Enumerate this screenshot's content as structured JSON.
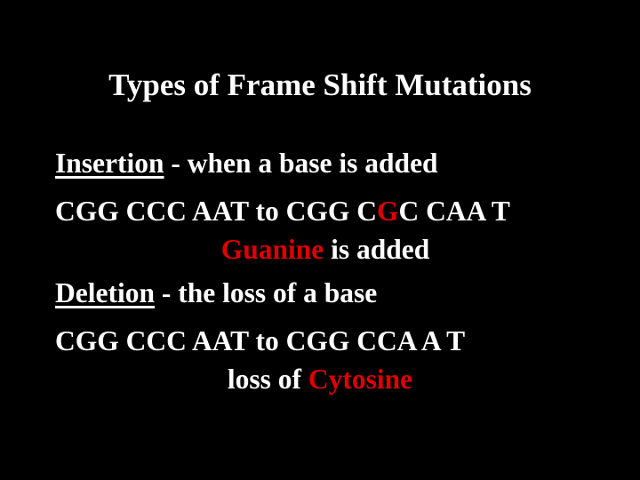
{
  "slide": {
    "title": "Types of Frame Shift Mutations",
    "accent_color": "#e00000",
    "insertion": {
      "term": "Insertion",
      "definition": " - when a base is added",
      "sequence_before": "CGG CCC AAT to CGG C",
      "sequence_highlight": "G",
      "sequence_after": "C CAA T",
      "note_highlight": "Guanine",
      "note_rest": " is added"
    },
    "deletion": {
      "term": "Deletion",
      "definition": " - the loss of a base",
      "sequence": "CGG CCC AAT to CGG CCA A T",
      "note_prefix": "loss of ",
      "note_highlight": "Cytosine"
    }
  }
}
